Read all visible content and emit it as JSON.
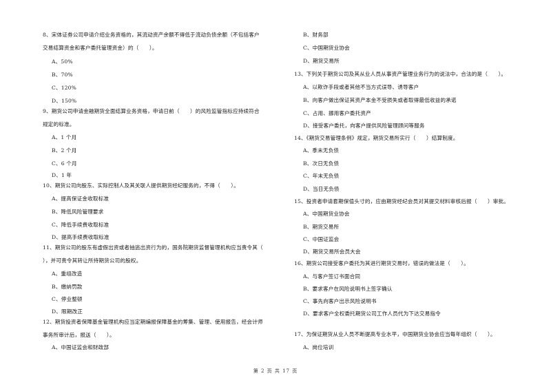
{
  "page": {
    "footer": "第 2 页 共 17 页"
  },
  "left": {
    "q8": {
      "line1": "8、宋体证券公司申请介绍业务资格的，其流动资产余额不得低于流动负债余额（不包括客户",
      "line2": "交易结算资金和客户委托管理资金）的（　　）。",
      "options": [
        "A、50%",
        "B、70%",
        "C、120%",
        "D、150%"
      ]
    },
    "q9": {
      "line1": "9、期货公司申请金融期货全面结算业务资格，申请日前（　　）的风险监管指标应持续符合",
      "line2": "规定的标准。",
      "options": [
        "A、1 个月",
        "B、2 个月",
        "C、6 个月",
        "D、1 年"
      ]
    },
    "q10": {
      "line1": "10、期货公司向股东、实际控制人及其关联人提供期货经纪服务的，不得（　　）。",
      "options": [
        "A、提高保证金收取标准",
        "B、降低风险管理要求",
        "C、降低手续费收取标准",
        "D、提高手续费收取标准"
      ]
    },
    "q11": {
      "line1": "11、期货公司的股东有虚假出资或者抽逃出资行为的，国务院期货监督管理机构应当责令其（",
      "line2": "），并可责令其转让所持期货公司的股权。",
      "options": [
        "A、重组改造",
        "B、缴纳罚款",
        "C、停业整顿",
        "D、限期改正"
      ]
    },
    "q12": {
      "line1": "12、期货投资者保障基金管理机构应当定期编报保障基金的筹集、管理、使用报告，经会计师",
      "line2": "事务所审计后，报送（　　）。",
      "options": [
        "A、中国证监会和财政部"
      ]
    }
  },
  "right": {
    "q12_cont": {
      "options": [
        "B、财务部",
        "C、中国期货业协会",
        "D、期货交易所"
      ]
    },
    "q13": {
      "line1": "13、下列关于期货公司及其从业人员从事资产管理业务行为的说法中，合法的是（　　）。",
      "options": [
        "A、以欺诈手段或者其他不当方式误导、诱导客户",
        "B、向客户做出保证其资产本金不受损失或者取得最低收益的承诺",
        "C、占用、挪用客户委托资产",
        "D、接受客户委托，向客户提供风险管理顾问等服务"
      ]
    },
    "q14": {
      "line1": "14、《期货交易管理条例》规定，期货交易所实行（　　）结算制度。",
      "options": [
        "A、季末无负债",
        "B、次日无负债",
        "C、年末无负债",
        "D、当日无负债"
      ]
    },
    "q15": {
      "line1": "15、投资者申请套期保值头寸的，应由期货经纪会员对其提交材料审核后报（　　）审批。",
      "options": [
        "A、中国期货业协会",
        "B、期货交易所",
        "C、中国证监会",
        "D、期货交易所会员大会"
      ]
    },
    "q16": {
      "line1": "16、期货公司接受客户委托为其进行期货交易时，错误的做法是（　　）。",
      "options": [
        "A、与客户签订书面合同",
        "B、要求客户在风险说明书上签字确认",
        "C、事先向客户出示风险说明书",
        "D、要求客户全权委托期货公司工作人员代为下达交易指令"
      ]
    },
    "q17": {
      "line1": "17、为保证期货从业人员不断提高专业水平，中国期货业协会应当每年组织（　　）。",
      "options": [
        "A、岗位培训"
      ]
    }
  }
}
